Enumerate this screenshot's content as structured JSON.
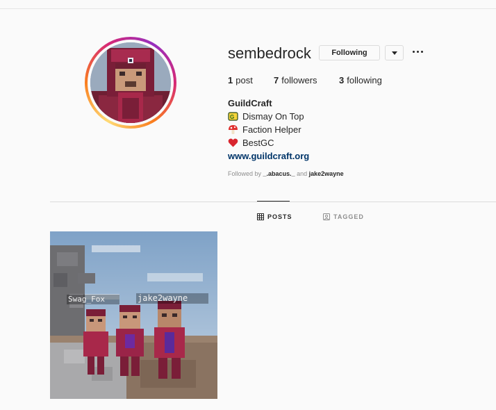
{
  "profile": {
    "username": "sembedrock",
    "follow_label": "Following",
    "posts_count": "1",
    "posts_label": "post",
    "followers_count": "7",
    "followers_label": "followers",
    "following_count": "3",
    "following_label": "following",
    "full_name": "GuildCraft",
    "bio": [
      {
        "icon": "guild-badge-icon",
        "text": "Dismay On Top"
      },
      {
        "icon": "mushroom-icon",
        "text": "Faction Helper"
      },
      {
        "icon": "heart-icon",
        "text": "BestGC"
      }
    ],
    "website": "www.guildcraft.org",
    "followed_by_prefix": "Followed by",
    "followed_by_user1": "_.abacus._",
    "followed_by_and": "and",
    "followed_by_user2": "jake2wayne"
  },
  "tabs": [
    {
      "label": "POSTS",
      "icon": "grid-icon",
      "active": true
    },
    {
      "label": "TAGGED",
      "icon": "tag-icon",
      "active": false
    }
  ],
  "post": {
    "nametag_left": "Swag_Fox",
    "nametag_right": "jake2wayne"
  },
  "colors": {
    "link": "#003569",
    "text": "#262626",
    "muted": "#8e8e8e",
    "border": "#dbdbdb",
    "background": "#fafafa"
  }
}
